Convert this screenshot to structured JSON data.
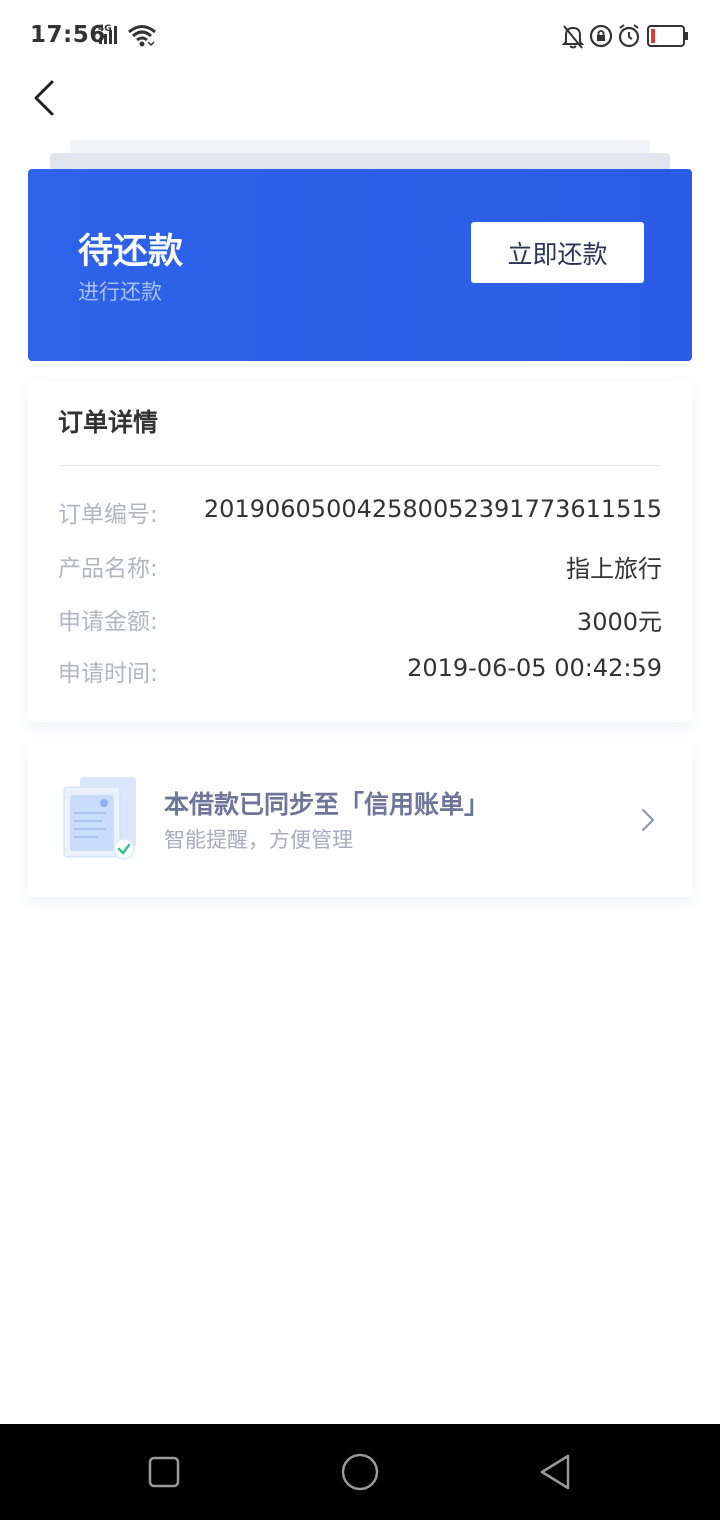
{
  "status_bar": {
    "time": "17:56",
    "network": "4G",
    "icons": [
      "signal-icon",
      "wifi-icon",
      "bell-muted-icon",
      "rotation-lock-icon",
      "alarm-icon",
      "battery-low-icon"
    ],
    "battery_color": "#e53935"
  },
  "hero": {
    "title": "待还款",
    "subtitle": "进行还款",
    "repay_label": "立即还款",
    "accent": "#2d63e9"
  },
  "order": {
    "title": "订单详情",
    "rows": [
      {
        "label": "订单编号:",
        "value": "20190605004258005239177361151​5"
      },
      {
        "label": "产品名称:",
        "value": "指上旅行"
      },
      {
        "label": "申请金额:",
        "value": "3000元"
      },
      {
        "label": "申请时间:",
        "value": "2019-06-05 00:42:59"
      }
    ]
  },
  "credit_bill": {
    "title": "本借款已同步至「信用账单」",
    "subtitle": "智能提醒，方便管理"
  },
  "nav_bar": {
    "buttons": [
      "recent-apps-icon",
      "home-icon",
      "back-triangle-icon"
    ]
  }
}
